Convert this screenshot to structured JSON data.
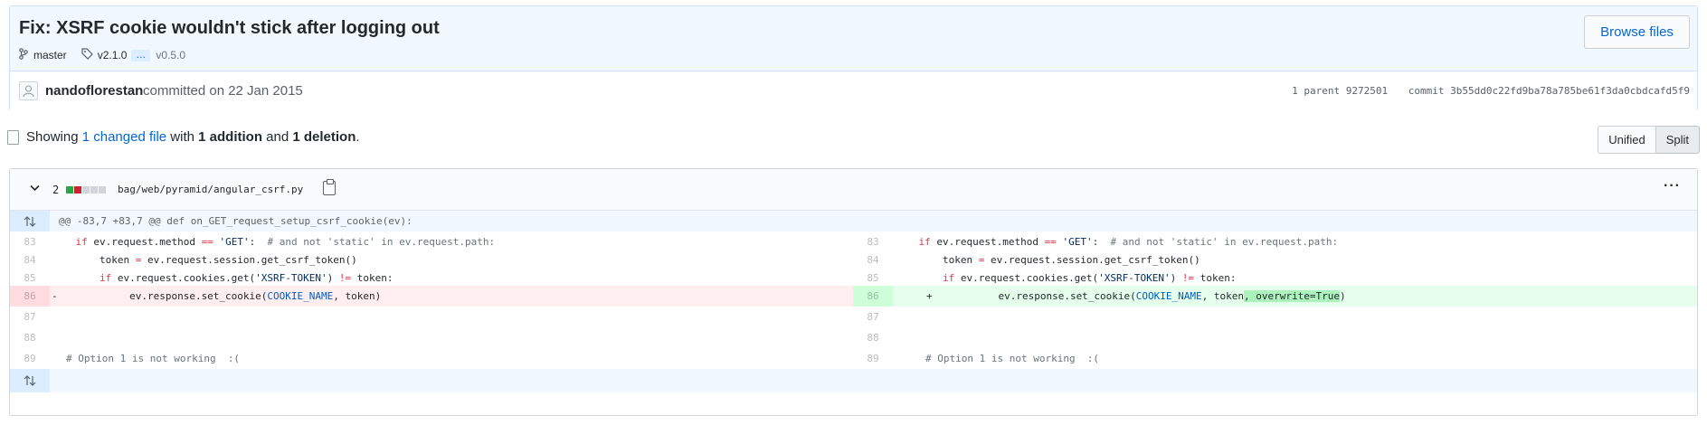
{
  "commit": {
    "title": "Fix: XSRF cookie wouldn't stick after logging out",
    "branch": "master",
    "tag": "v2.1.0",
    "more_tags": "…",
    "tag_last": "v0.5.0",
    "browse_label": "Browse files",
    "author": "nandoflorestan",
    "committed_text": "committed on 22 Jan 2015",
    "parent_text": "1 parent 9272501",
    "commit_text": "commit 3b55dd0c22fd9ba78a785be61f3da0cbdcafd5f9"
  },
  "toc": {
    "showing": "Showing",
    "changed_files": "1 changed file",
    "with": "with",
    "additions": "1 addition",
    "and": "and",
    "deletions": "1 deletion",
    "period": ".",
    "unified_label": "Unified",
    "split_label": "Split"
  },
  "file": {
    "changes": "2",
    "diffstat": [
      "add",
      "del",
      "neutral",
      "neutral",
      "neutral"
    ],
    "path": "bag/web/pyramid/angular_csrf.py",
    "hunk_header": "@@ -83,7 +83,7 @@ def on_GET_request_setup_csrf_cookie(ev):"
  },
  "diff": {
    "left": [
      {
        "num": "83",
        "code": "    if ev.request.method == 'GET':  # and not 'static' in ev.request.path:"
      },
      {
        "num": "84",
        "code": "        token = ev.request.session.get_csrf_token()"
      },
      {
        "num": "85",
        "code": "        if ev.request.cookies.get('XSRF-TOKEN') != token:"
      },
      {
        "num": "86",
        "code": "            ev.response.set_cookie(COOKIE_NAME, token)",
        "sign": "-"
      },
      {
        "num": "87",
        "code": ""
      },
      {
        "num": "88",
        "code": ""
      },
      {
        "num": "89",
        "code": "# Option 1 is not working  :("
      }
    ],
    "right": [
      {
        "num": "83",
        "code": "    if ev.request.method == 'GET':  # and not 'static' in ev.request.path:"
      },
      {
        "num": "84",
        "code": "        token = ev.request.session.get_csrf_token()"
      },
      {
        "num": "85",
        "code": "        if ev.request.cookies.get('XSRF-TOKEN') != token:"
      },
      {
        "num": "86",
        "code": "            ev.response.set_cookie(COOKIE_NAME, token, overwrite=True)",
        "sign": "+"
      },
      {
        "num": "87",
        "code": ""
      },
      {
        "num": "88",
        "code": ""
      },
      {
        "num": "89",
        "code": "# Option 1 is not working  :("
      }
    ]
  },
  "colors": {
    "accent": "#0366d6",
    "addition": "#28a745",
    "deletion": "#cb2431",
    "header_bg": "#f1f8ff"
  },
  "icons": [
    "branch-icon",
    "tag-icon",
    "file-diff-icon",
    "chevron-down-icon",
    "clipboard-icon",
    "kebab-icon",
    "expand-icon"
  ]
}
